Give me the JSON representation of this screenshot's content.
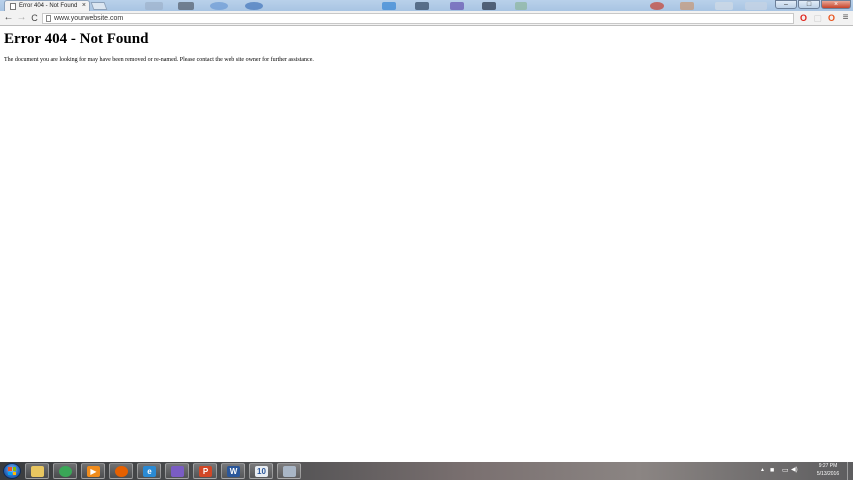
{
  "browser": {
    "tab": {
      "title": "Error 404 - Not Found",
      "close_glyph": "×"
    },
    "toolbar": {
      "back_glyph": "←",
      "forward_glyph": "→",
      "reload_glyph": "C",
      "url": "www.yourwebsite.com",
      "menu_glyph": "≡"
    },
    "window_controls": {
      "minimize_glyph": "–",
      "maximize_glyph": "□",
      "close_glyph": "×"
    },
    "extensions": [
      {
        "name": "opera-icon",
        "glyph": "O",
        "color": "#e0241c"
      },
      {
        "name": "extension-icon",
        "glyph": "▢",
        "color": "#cfcfcf"
      },
      {
        "name": "office-icon",
        "glyph": "O",
        "color": "#e8541e"
      }
    ]
  },
  "page": {
    "title": "Error 404 - Not Found",
    "message": "The document you are looking for may have been removed or re-named. Please contact the web site owner for further assistance."
  },
  "taskbar": {
    "pinned": [
      {
        "name": "file-explorer-icon",
        "glyph": "",
        "color": "#e8c660"
      },
      {
        "name": "chrome-icon",
        "glyph": "",
        "color": "#3aa757"
      },
      {
        "name": "media-player-icon",
        "glyph": "▶",
        "color": "#f08c1c"
      },
      {
        "name": "firefox-icon",
        "glyph": "",
        "color": "#e66000"
      },
      {
        "name": "internet-explorer-icon",
        "glyph": "e",
        "color": "#2a8ad4"
      },
      {
        "name": "paint-app-icon",
        "glyph": "",
        "color": "#7a5cc4"
      },
      {
        "name": "powerpoint-icon",
        "glyph": "P",
        "color": "#d24726"
      },
      {
        "name": "word-icon",
        "glyph": "W",
        "color": "#2b579a"
      },
      {
        "name": "calendar-app-icon",
        "glyph": "10",
        "color": "#e9edf2"
      },
      {
        "name": "generic-app-icon",
        "glyph": "",
        "color": "#a9b6c6"
      }
    ],
    "tray": {
      "show_hidden_glyph": "▲",
      "flag_glyph": "■",
      "network_glyph": "▭",
      "volume_glyph": "◀)",
      "time": "9:27 PM",
      "date": "5/13/2016"
    },
    "colors": {
      "start_orb": "#2b6dc2"
    }
  }
}
